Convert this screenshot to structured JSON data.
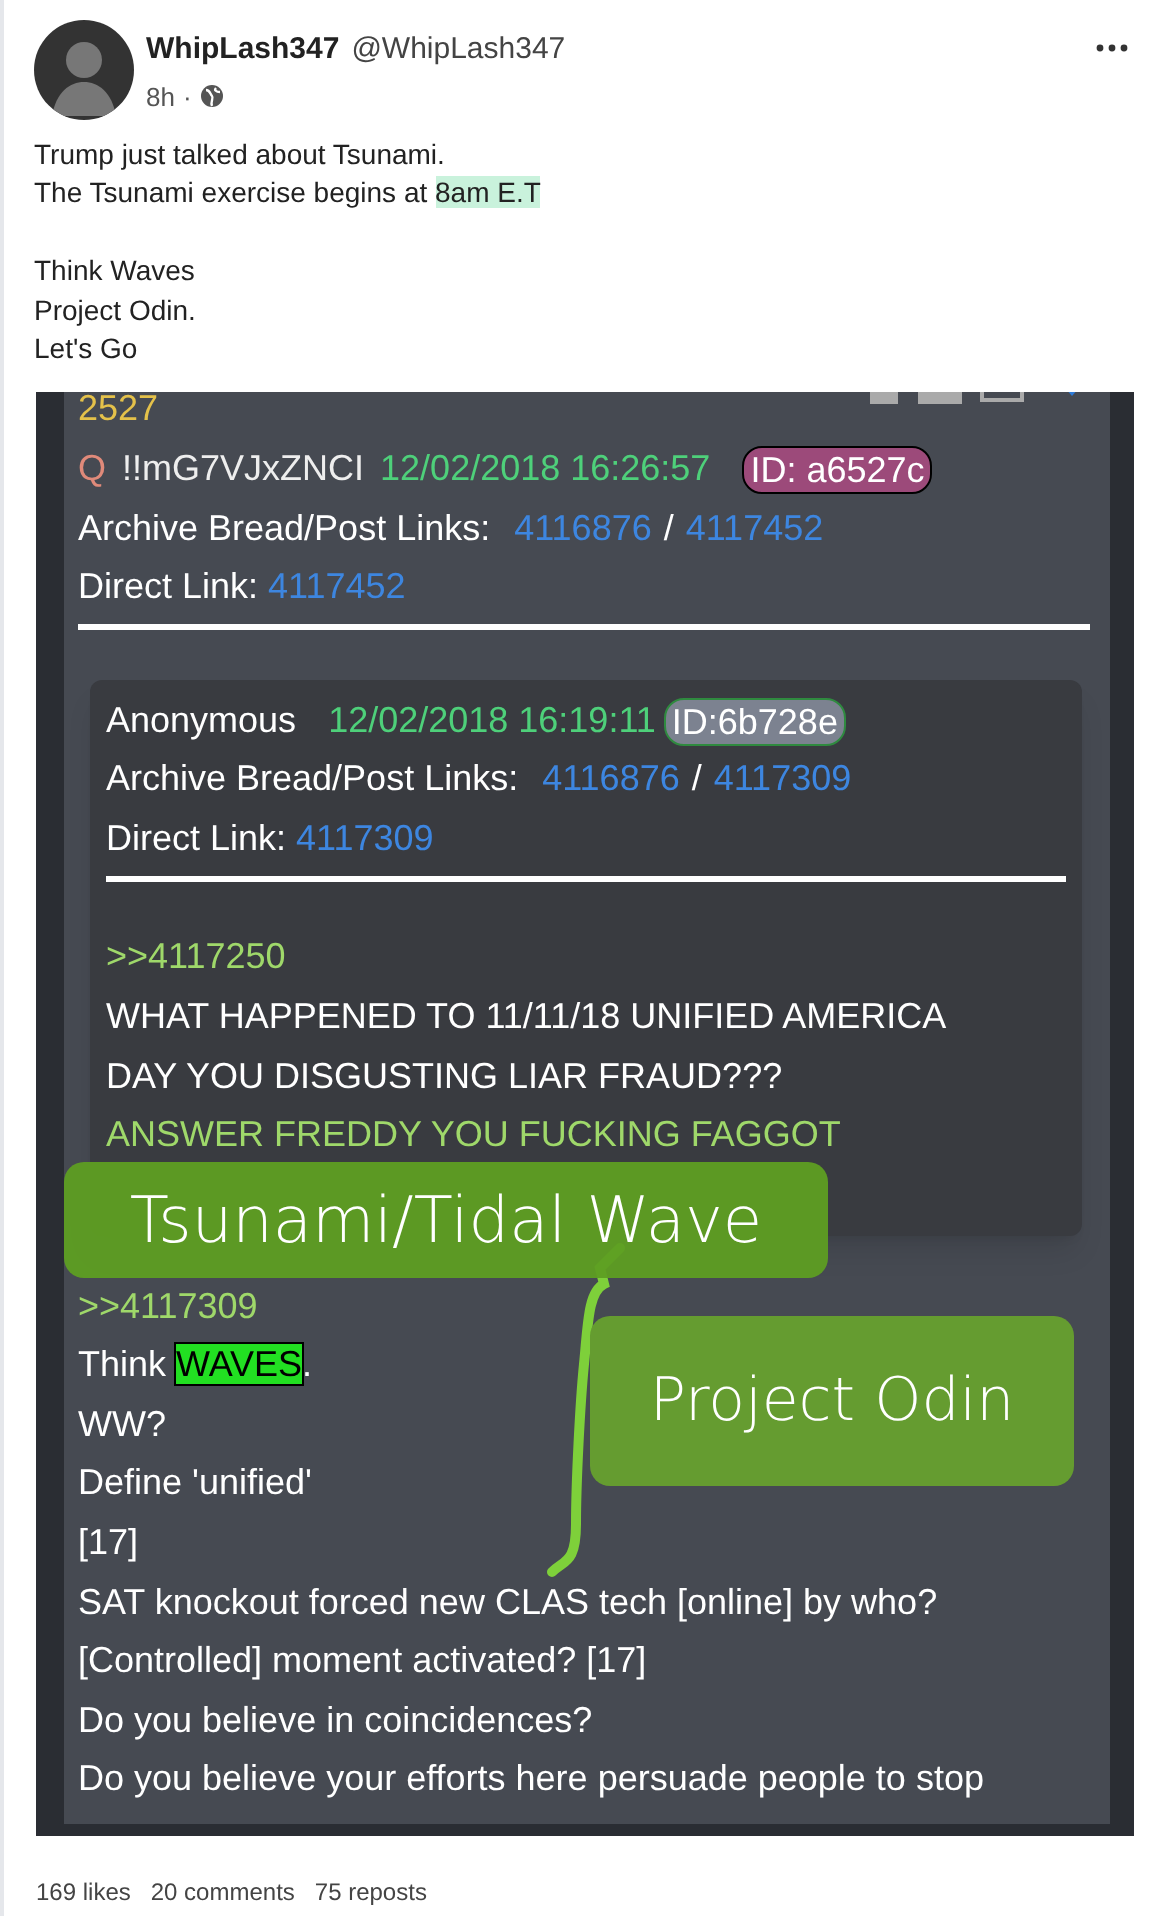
{
  "post": {
    "author": "WhipLash347",
    "handle": "@WhipLash347",
    "time": "8h",
    "separator": "·",
    "paragraphs": [
      [
        [
          {
            "text": "Trump just talked about Tsunami.",
            "highlighted": false
          }
        ],
        [
          {
            "text": "The Tsunami exercise begins at ",
            "highlighted": false
          },
          {
            "text": "8am E.T",
            "highlighted": true
          }
        ]
      ],
      [
        [
          {
            "text": "Think Waves",
            "highlighted": false
          }
        ],
        [
          {
            "text": "Project Odin.",
            "highlighted": false
          }
        ],
        [
          {
            "text": "Let's Go",
            "highlighted": false
          }
        ]
      ]
    ],
    "stats": [
      "169 likes",
      "20 comments",
      "75 reposts"
    ]
  },
  "screenshot": {
    "post_number": "2527",
    "header": {
      "marker": "Q",
      "tripcode": "!!mG7VJxZNCI",
      "timestamp": "12/02/2018 16:26:57",
      "id_badge": "ID: a6527c"
    },
    "archive": {
      "label": "Archive Bread/Post Links:",
      "link_1": "4116876",
      "separator": "/",
      "link_2": "4117452"
    },
    "direct": {
      "label": "Direct Link:",
      "link": "4117452"
    },
    "quoted": {
      "author": "Anonymous",
      "timestamp": "12/02/2018 16:19:11",
      "id_badge": "ID:6b728e",
      "archive": {
        "label": "Archive Bread/Post Links:",
        "link_1": "4116876",
        "separator": "/",
        "link_2": "4117309"
      },
      "direct": {
        "label": "Direct Link:",
        "link": "4117309"
      },
      "lines": [
        {
          "kind": "reply",
          "segments": [
            {
              "text": ">>4117250",
              "highlighted": false
            }
          ]
        },
        {
          "kind": "text",
          "segments": [
            {
              "text": "WHAT HAPPENED TO 11/11/18 UNIFIED AMERICA",
              "highlighted": false
            }
          ]
        },
        {
          "kind": "text",
          "segments": [
            {
              "text": "DAY YOU DISGUSTING LIAR FRAUD???",
              "highlighted": false
            }
          ]
        },
        {
          "kind": "reply",
          "segments": [
            {
              "text": "ANSWER FREDDY YOU FUCKING FAGGOT",
              "highlighted": false
            }
          ]
        }
      ]
    },
    "lines": [
      {
        "kind": "reply",
        "segments": [
          {
            "text": ">>4117309",
            "highlighted": false
          }
        ]
      },
      {
        "kind": "text",
        "segments": [
          {
            "text": "Think ",
            "highlighted": false
          },
          {
            "text": "WAVES",
            "highlighted": true
          },
          {
            "text": ".",
            "highlighted": false
          }
        ]
      },
      {
        "kind": "text",
        "segments": [
          {
            "text": "WW?",
            "highlighted": false
          }
        ]
      },
      {
        "kind": "text",
        "segments": [
          {
            "text": "Define 'unified'",
            "highlighted": false
          }
        ]
      },
      {
        "kind": "text",
        "segments": [
          {
            "text": "[17]",
            "highlighted": false
          }
        ]
      },
      {
        "kind": "text",
        "segments": [
          {
            "text": "SAT knockout forced new CLAS tech [online] by who?",
            "highlighted": false
          }
        ]
      },
      {
        "kind": "text",
        "segments": [
          {
            "text": "[Controlled] moment activated? [17]",
            "highlighted": false
          }
        ]
      },
      {
        "kind": "text",
        "segments": [
          {
            "text": "Do you believe in coincidences?",
            "highlighted": false
          }
        ]
      },
      {
        "kind": "text",
        "segments": [
          {
            "text": "Do you believe your efforts here persuade people to stop",
            "highlighted": false
          }
        ]
      }
    ],
    "annotations": [
      "Tsunami/Tidal Wave",
      "Project Odin"
    ]
  }
}
